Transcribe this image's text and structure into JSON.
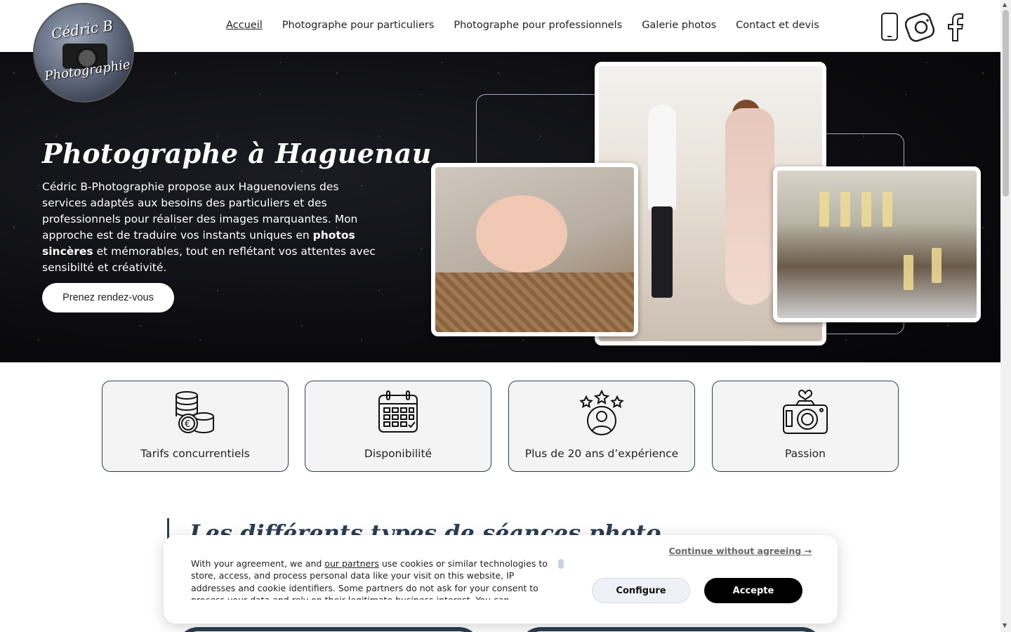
{
  "logo": {
    "line1": "Cédric B",
    "line2": "Photographie"
  },
  "nav": {
    "items": [
      {
        "label": "Accueil",
        "active": true
      },
      {
        "label": "Photographe pour particuliers"
      },
      {
        "label": "Photographe pour professionnels"
      },
      {
        "label": "Galerie photos"
      },
      {
        "label": "Contact et devis"
      }
    ]
  },
  "social": {
    "icons": [
      "phone-icon",
      "instagram-icon",
      "facebook-icon"
    ]
  },
  "hero": {
    "title": "Photographe à Haguenau",
    "text_1": "Cédric B-Photographie propose aux Haguenoviens des services adaptés aux besoins des particuliers et des professionnels pour réaliser des images marquantes. Mon approche est de traduire vos instants uniques en ",
    "text_bold": "photos sincères",
    "text_2": " et mémorables, tout en reflétant vos attentes avec sensibilté et créativité.",
    "cta": "Prenez rendez-vous"
  },
  "features": [
    {
      "label": "Tarifs concurrentiels",
      "icon": "coins-euro-icon"
    },
    {
      "label": "Disponibilité",
      "icon": "calendar-icon"
    },
    {
      "label": "Plus de 20 ans d’expérience",
      "icon": "stars-user-icon"
    },
    {
      "label": "Passion",
      "icon": "camera-heart-icon"
    }
  ],
  "section": {
    "title": "Les différents types de séances photo"
  },
  "cookie": {
    "continue": "Continue without agreeing →",
    "text_before": "With your agreement, we and ",
    "partners_link": "our partners",
    "text_after": " use cookies or similar technologies to store, access, and process personal data like your visit on this website, IP addresses and cookie identifiers. Some partners do not ask for your consent to process your data and rely on their legitimate business interest. You can",
    "configure": "Configure",
    "accept": "Accepte"
  },
  "colors": {
    "accent": "#2c3e50",
    "card_bg": "#f4f4f4",
    "hero_bg": "#0c0c10"
  }
}
